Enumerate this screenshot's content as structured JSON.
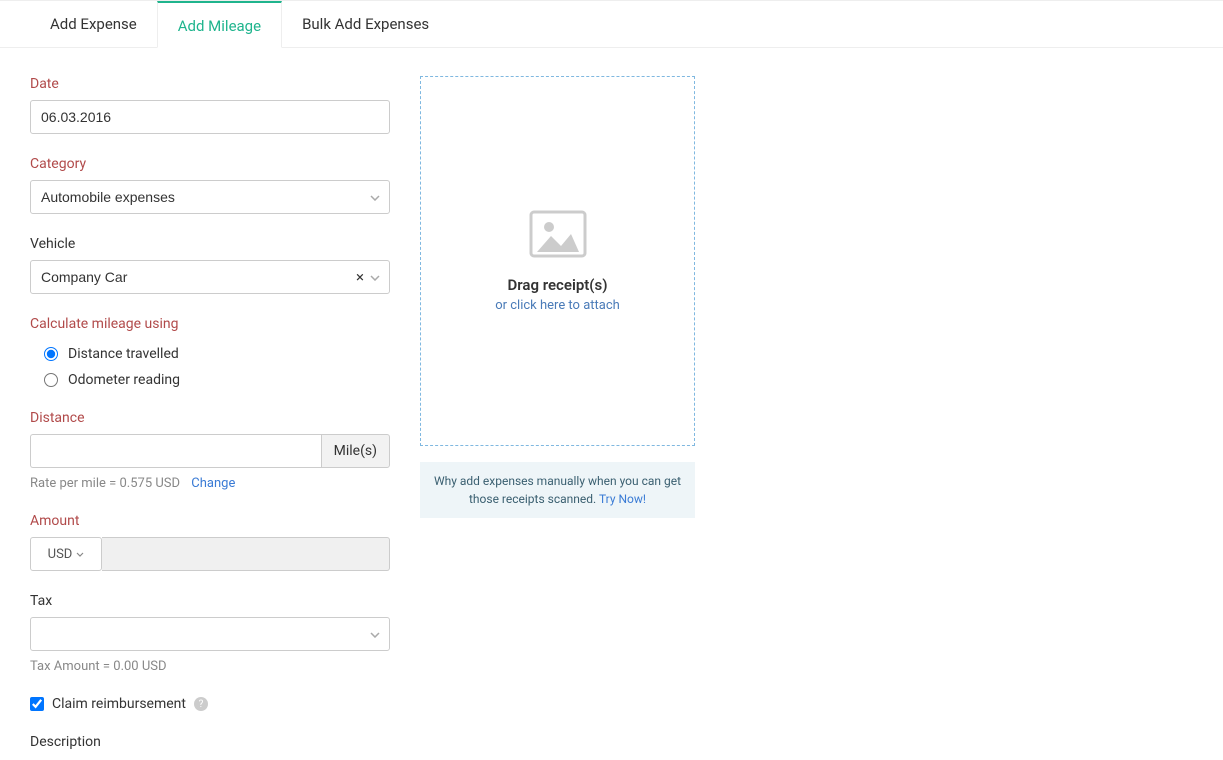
{
  "tabs": {
    "add_expense": "Add Expense",
    "add_mileage": "Add Mileage",
    "bulk_add": "Bulk Add Expenses"
  },
  "form": {
    "date_label": "Date",
    "date_value": "06.03.2016",
    "category_label": "Category",
    "category_value": "Automobile expenses",
    "vehicle_label": "Vehicle",
    "vehicle_value": "Company Car",
    "calc_label": "Calculate mileage using",
    "radio_distance": "Distance travelled",
    "radio_odometer": "Odometer reading",
    "distance_label": "Distance",
    "distance_value": "",
    "distance_unit": "Mile(s)",
    "rate_hint": "Rate per mile = 0.575 USD",
    "rate_change": "Change",
    "amount_label": "Amount",
    "currency": "USD",
    "amount_value": "",
    "tax_label": "Tax",
    "tax_value": "",
    "tax_hint": "Tax Amount = 0.00  USD",
    "claim_label": "Claim reimbursement",
    "description_label": "Description"
  },
  "upload": {
    "drag_title": "Drag receipt(s)",
    "drag_sub": "or click here to attach",
    "promo_text": "Why add expenses manually when you can get those receipts scanned.",
    "promo_link": "Try Now!"
  }
}
